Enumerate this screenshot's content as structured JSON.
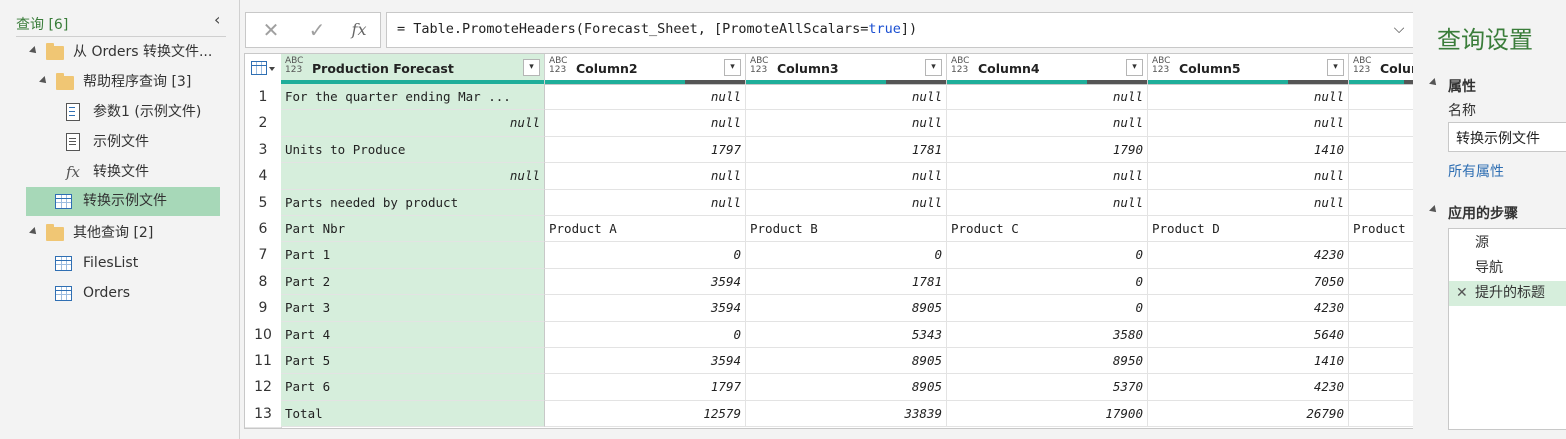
{
  "queries_pane": {
    "header": "查询 [6]",
    "items": [
      {
        "label": "从 Orders 转换文件...",
        "type": "folder",
        "level": 0
      },
      {
        "label": "帮助程序查询 [3]",
        "type": "folder",
        "level": 1
      },
      {
        "label": "参数1 (示例文件)",
        "type": "parameter",
        "level": 2
      },
      {
        "label": "示例文件",
        "type": "document",
        "level": 2
      },
      {
        "label": "转换文件",
        "type": "function",
        "level": 2
      },
      {
        "label": "转换示例文件",
        "type": "table",
        "level": 1,
        "selected": true
      },
      {
        "label": "其他查询 [2]",
        "type": "folder",
        "level": 0
      },
      {
        "label": "FilesList",
        "type": "table",
        "level": 1
      },
      {
        "label": "Orders",
        "type": "table",
        "level": 1
      }
    ]
  },
  "formula_bar": {
    "cancel_icon": "✕",
    "commit_icon": "✓",
    "fx_label": "fx",
    "formula_prefix": "= Table.PromoteHeaders(Forecast_Sheet, [PromoteAllScalars=",
    "formula_keyword": "true",
    "formula_suffix": "])"
  },
  "grid": {
    "type_badge_top": "ABC",
    "type_badge_bottom": "123",
    "columns": [
      "Production Forecast",
      "Column2",
      "Column3",
      "Column4",
      "Column5",
      "Colum"
    ],
    "rows": [
      [
        "For the quarter ending Mar ...",
        "null",
        "null",
        "null",
        "null",
        ""
      ],
      [
        "null",
        "null",
        "null",
        "null",
        "null",
        ""
      ],
      [
        "Units to Produce",
        "1797",
        "1781",
        "1790",
        "1410",
        ""
      ],
      [
        "null",
        "null",
        "null",
        "null",
        "null",
        ""
      ],
      [
        "Parts needed by product",
        "null",
        "null",
        "null",
        "null",
        ""
      ],
      [
        "Part Nbr",
        "Product A",
        "Product B",
        "Product C",
        "Product D",
        "Product"
      ],
      [
        "Part 1",
        "0",
        "0",
        "0",
        "4230",
        ""
      ],
      [
        "Part 2",
        "3594",
        "1781",
        "0",
        "7050",
        ""
      ],
      [
        "Part 3",
        "3594",
        "8905",
        "0",
        "4230",
        ""
      ],
      [
        "Part 4",
        "0",
        "5343",
        "3580",
        "5640",
        ""
      ],
      [
        "Part 5",
        "3594",
        "8905",
        "8950",
        "1410",
        ""
      ],
      [
        "Part 6",
        "1797",
        "8905",
        "5370",
        "4230",
        ""
      ],
      [
        "Total",
        "12579",
        "33839",
        "17900",
        "26790",
        ""
      ]
    ],
    "row_numbers": [
      "1",
      "2",
      "3",
      "4",
      "5",
      "6",
      "7",
      "8",
      "9",
      "10",
      "11",
      "12",
      "13"
    ]
  },
  "settings_pane": {
    "title": "查询设置",
    "properties_header": "属性",
    "name_label": "名称",
    "name_value": "转换示例文件",
    "all_properties_link": "所有属性",
    "applied_steps_header": "应用的步骤",
    "steps": [
      {
        "label": "源",
        "active": false
      },
      {
        "label": "导航",
        "active": false
      },
      {
        "label": "提升的标题",
        "active": true
      }
    ]
  },
  "colors": {
    "accent_green": "#3a7d3a",
    "selected_bg": "#a7d8b8",
    "column_quality_bar": "#1fae9a",
    "keyword_blue": "#1a4fd1"
  }
}
